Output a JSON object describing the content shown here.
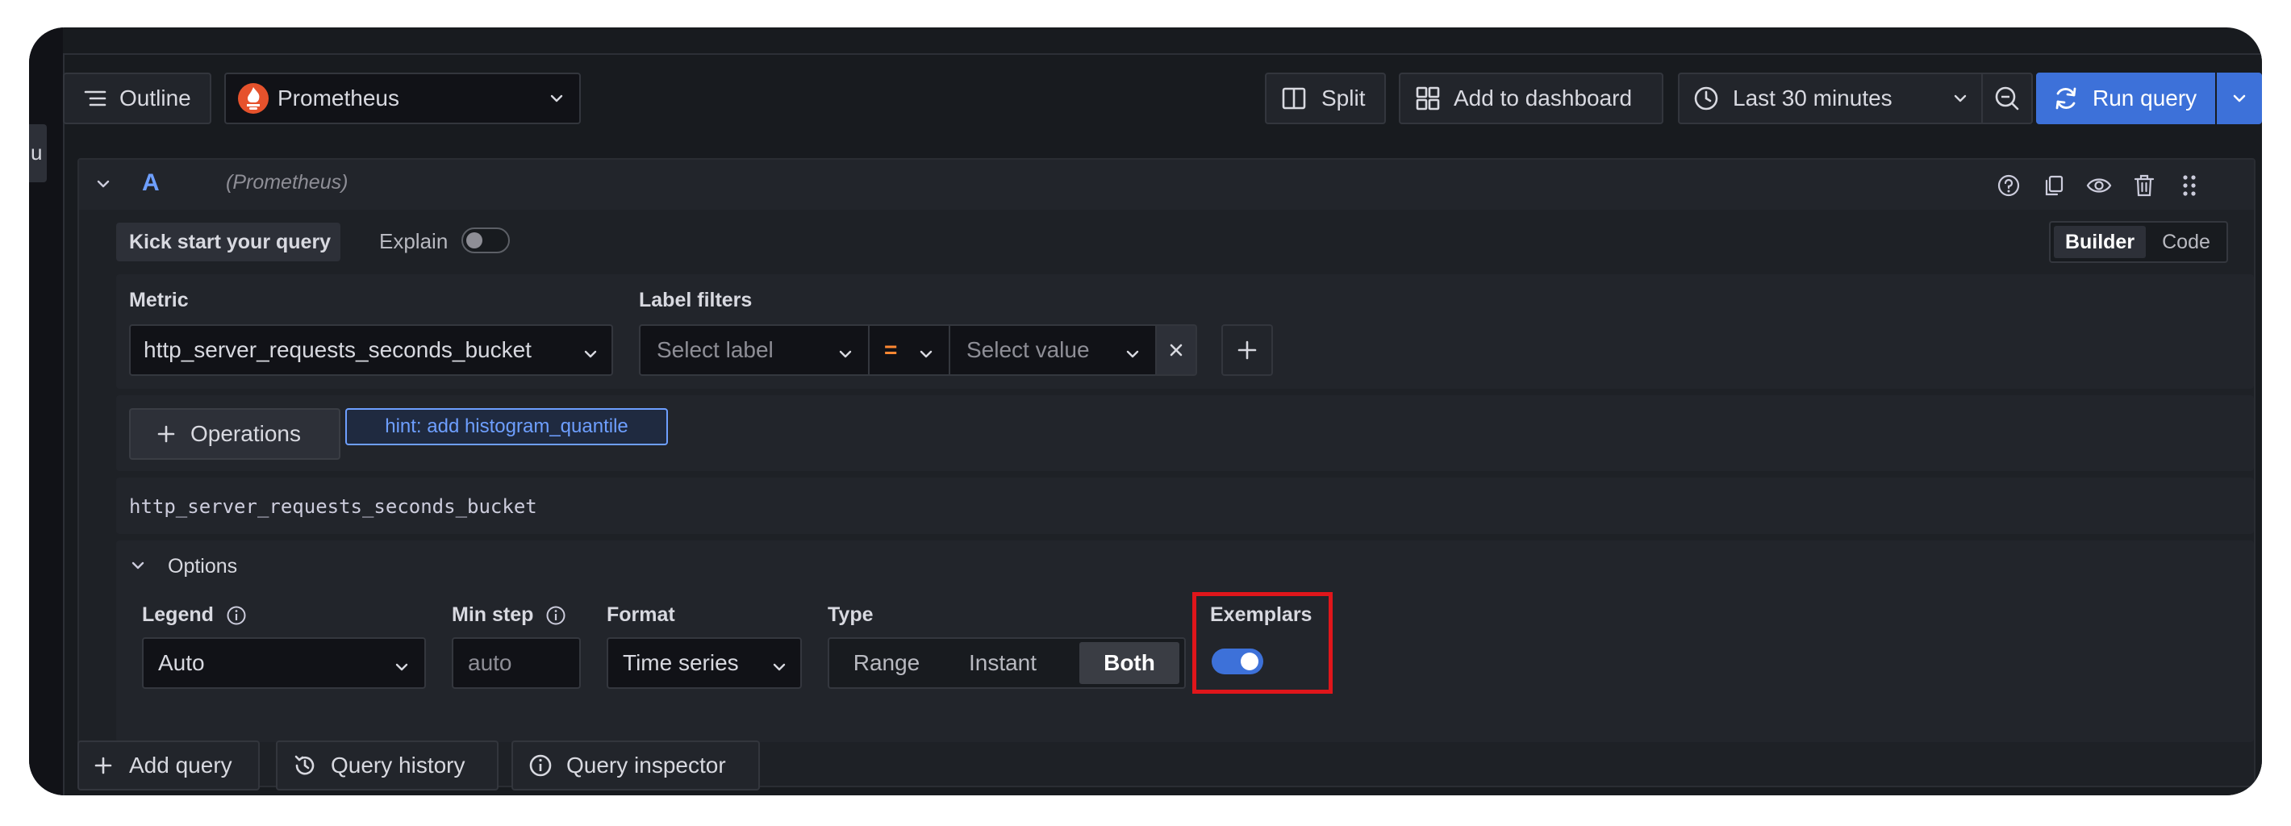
{
  "toolbar": {
    "outline_label": "Outline",
    "datasource": "Prometheus",
    "split_label": "Split",
    "add_to_dashboard_label": "Add to dashboard",
    "time_range": "Last 30 minutes",
    "run_query_label": "Run query"
  },
  "side_tab_fragment": "u",
  "query": {
    "ref_id": "A",
    "datasource_hint": "(Prometheus)",
    "kick_start_label": "Kick start your query",
    "explain_label": "Explain",
    "explain_enabled": false,
    "mode_options": [
      "Builder",
      "Code"
    ],
    "mode_selected": "Builder",
    "metric_label": "Metric",
    "metric_value": "http_server_requests_seconds_bucket",
    "label_filters_label": "Label filters",
    "select_label_placeholder": "Select label",
    "operator": "=",
    "select_value_placeholder": "Select value",
    "operations_label": "Operations",
    "hint_label": "hint: add histogram_quantile",
    "query_preview": "http_server_requests_seconds_bucket"
  },
  "options": {
    "title": "Options",
    "legend_label": "Legend",
    "legend_value": "Auto",
    "min_step_label": "Min step",
    "min_step_placeholder": "auto",
    "format_label": "Format",
    "format_value": "Time series",
    "type_label": "Type",
    "type_options": [
      "Range",
      "Instant",
      "Both"
    ],
    "type_selected": "Both",
    "exemplars_label": "Exemplars",
    "exemplars_enabled": true
  },
  "footer": {
    "add_query_label": "Add query",
    "query_history_label": "Query history",
    "query_inspector_label": "Query inspector"
  },
  "colors": {
    "accent": "#3d71d9",
    "highlight": "#e0161b",
    "hint": "#6e9fff",
    "operator": "#ff8833",
    "prometheus_brand": "#e6522c"
  }
}
